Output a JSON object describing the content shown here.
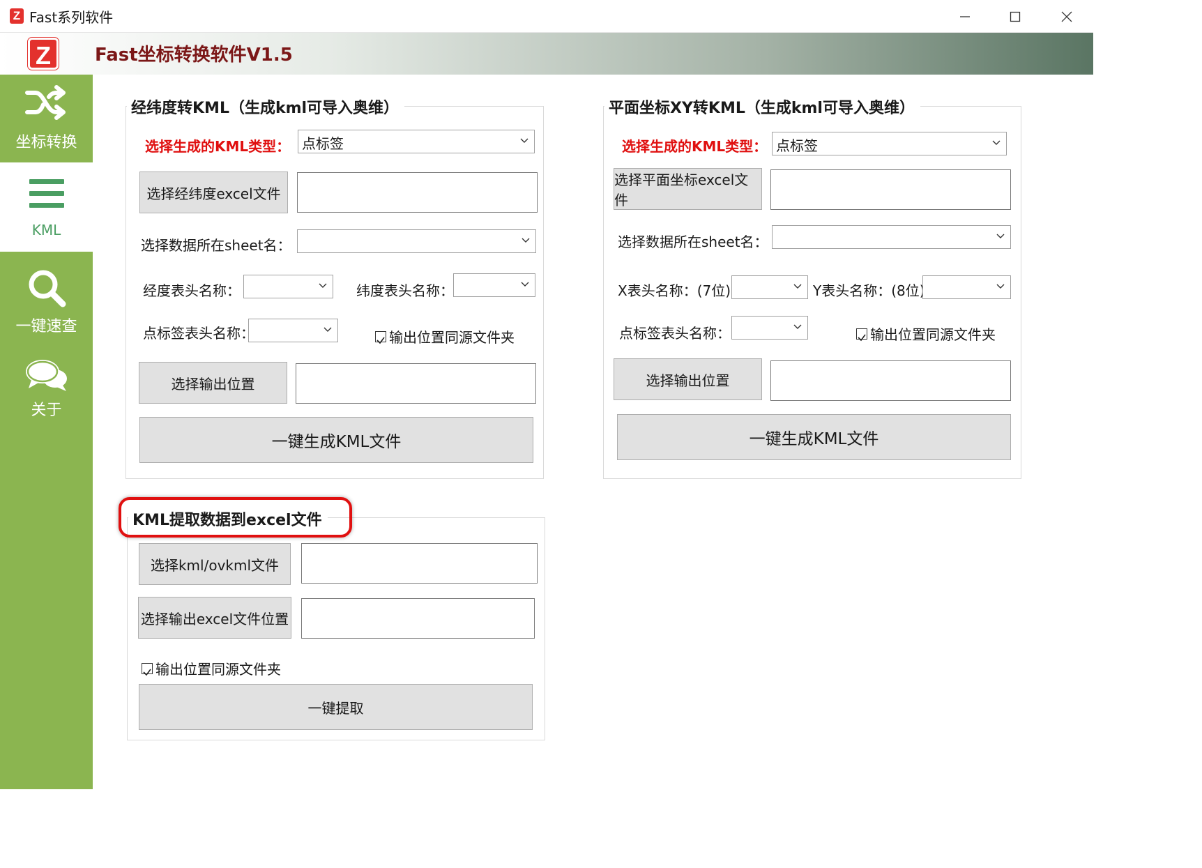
{
  "window": {
    "title": "Fast系列软件",
    "logo_letter": "Z"
  },
  "header": {
    "logo_letter": "Z",
    "app_title": "Fast坐标转换软件V1.5"
  },
  "sidebar": {
    "items": [
      {
        "label": "坐标转换",
        "icon": "shuffle-icon"
      },
      {
        "label": "KML",
        "icon": "menu-icon"
      },
      {
        "label": "一键速查",
        "icon": "search-icon"
      },
      {
        "label": "关于",
        "icon": "chat-icon"
      }
    ]
  },
  "latlon_panel": {
    "title": "经纬度转KML（生成kml可导入奥维）",
    "type_label": "选择生成的KML类型：",
    "type_value": "点标签",
    "select_file_button": "选择经纬度excel文件",
    "file_path": "",
    "sheet_label": "选择数据所在sheet名：",
    "sheet_value": "",
    "lon_label": "经度表头名称：",
    "lon_value": "",
    "lat_label": "纬度表头名称：",
    "lat_value": "",
    "point_label": "点标签表头名称：",
    "point_value": "",
    "same_folder_label": "输出位置同源文件夹",
    "same_folder_checked": true,
    "output_button": "选择输出位置",
    "output_path": "",
    "generate_button": "一键生成KML文件"
  },
  "xy_panel": {
    "title": "平面坐标XY转KML（生成kml可导入奥维）",
    "type_label": "选择生成的KML类型：",
    "type_value": "点标签",
    "select_file_button": "选择平面坐标excel文件",
    "file_path": "",
    "sheet_label": "选择数据所在sheet名：",
    "sheet_value": "",
    "x_label": "X表头名称：(7位)",
    "x_value": "",
    "y_label": "Y表头名称：(8位)",
    "y_value": "",
    "point_label": "点标签表头名称：",
    "point_value": "",
    "same_folder_label": "输出位置同源文件夹",
    "same_folder_checked": true,
    "output_button": "选择输出位置",
    "output_path": "",
    "generate_button": "一键生成KML文件"
  },
  "extract_panel": {
    "title": "KML提取数据到excel文件",
    "select_kml_button": "选择kml/ovkml文件",
    "kml_path": "",
    "output_button": "选择输出excel文件位置",
    "output_path": "",
    "same_folder_label": "输出位置同源文件夹",
    "same_folder_checked": true,
    "extract_button": "一键提取"
  },
  "colors": {
    "sidebar": "#8bb550",
    "active_nav_text": "#4a9e62",
    "heading": "#7b1717",
    "required_label": "#e01010",
    "logo": "#e3312d",
    "highlight": "#e01010"
  }
}
